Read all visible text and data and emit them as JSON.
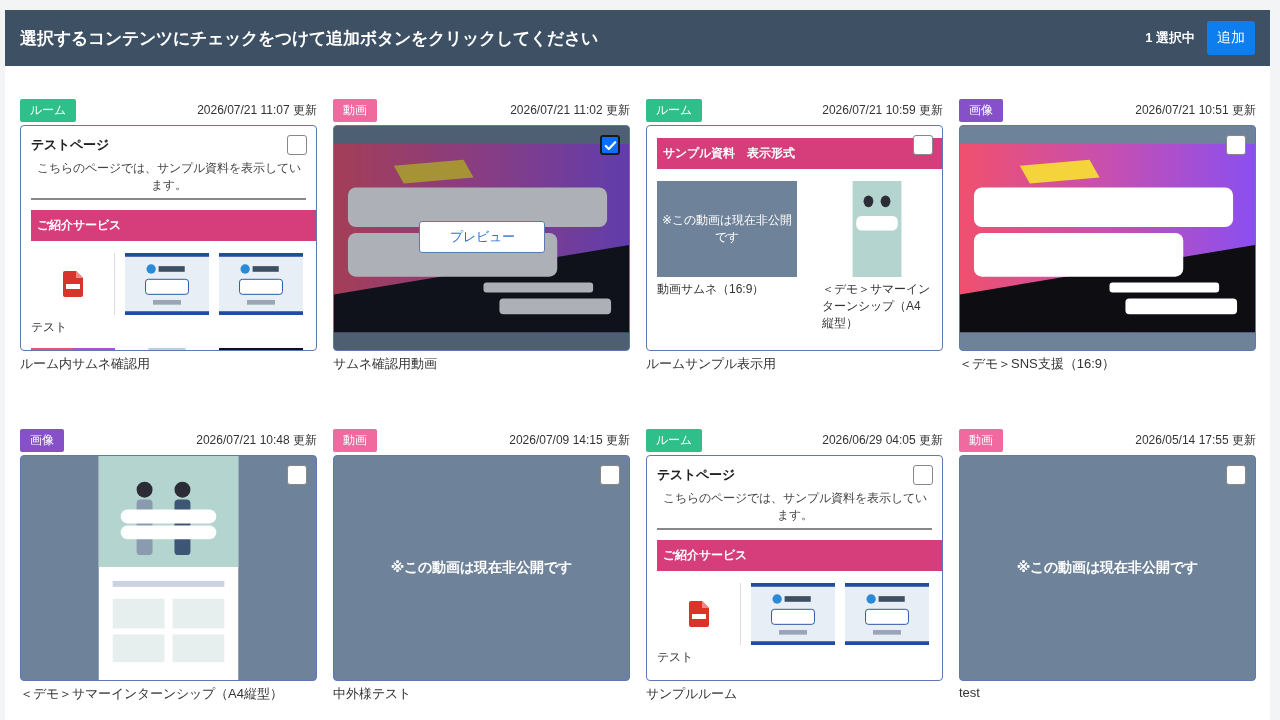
{
  "header": {
    "title": "選択するコンテンツにチェックをつけて追加ボタンをクリックしてください",
    "selection_count": "1 選択中",
    "add_button": "追加"
  },
  "cards": [
    {
      "tag": {
        "label": "ルーム",
        "color": "#2fbf8a"
      },
      "updated": "2026/07/21 11:07 更新",
      "title": "ルーム内サムネ確認用",
      "selected": false,
      "thumbnail": {
        "kind": "room",
        "heading": "テストページ",
        "intro": "こちらのページでは、サンプル資料を表示しています。",
        "section": "ご紹介サービス",
        "items": [
          {
            "kind": "pdf",
            "caption": "テスト"
          },
          {
            "kind": "tile"
          },
          {
            "kind": "tile"
          },
          {
            "kind": "banner"
          },
          {
            "kind": "poster"
          },
          {
            "kind": "dark"
          }
        ]
      }
    },
    {
      "tag": {
        "label": "動画",
        "color": "#f06aa0"
      },
      "updated": "2026/07/21 11:02 更新",
      "title": "サムネ確認用動画",
      "selected": true,
      "preview": {
        "label": "プレビュー"
      },
      "thumbnail": {
        "kind": "banner"
      }
    },
    {
      "tag": {
        "label": "ルーム",
        "color": "#2fbf8a"
      },
      "updated": "2026/07/21 10:59 更新",
      "title": "ルームサンプル表示用",
      "selected": false,
      "thumbnail": {
        "kind": "room",
        "section": "サンプル資料　表示形式",
        "items": [
          {
            "kind": "private",
            "text": "※この動画は現在非公開です",
            "caption": "動画サムネ（16:9）"
          },
          {
            "kind": "poster",
            "caption": "＜デモ＞サマーインターンシップ（A4縦型）"
          }
        ]
      }
    },
    {
      "tag": {
        "label": "画像",
        "color": "#8550c8"
      },
      "updated": "2026/07/21 10:51 更新",
      "title": "＜デモ＞SNS支援（16:9）",
      "selected": false,
      "thumbnail": {
        "kind": "banner"
      }
    },
    {
      "tag": {
        "label": "画像",
        "color": "#8550c8"
      },
      "updated": "2026/07/21 10:48 更新",
      "title": "＜デモ＞サマーインターンシップ（A4縦型）",
      "selected": false,
      "thumbnail": {
        "kind": "poster"
      }
    },
    {
      "tag": {
        "label": "動画",
        "color": "#f06aa0"
      },
      "updated": "2026/07/09 14:15 更新",
      "title": "中外様テスト",
      "selected": false,
      "thumbnail": {
        "kind": "private",
        "text": "※この動画は現在非公開です"
      }
    },
    {
      "tag": {
        "label": "ルーム",
        "color": "#2fbf8a"
      },
      "updated": "2026/06/29 04:05 更新",
      "title": "サンプルルーム",
      "selected": false,
      "thumbnail": {
        "kind": "room",
        "heading": "テストページ",
        "intro": "こちらのページでは、サンプル資料を表示しています。",
        "section": "ご紹介サービス",
        "items": [
          {
            "kind": "pdf",
            "caption": "テスト"
          },
          {
            "kind": "tile"
          },
          {
            "kind": "tile"
          }
        ]
      }
    },
    {
      "tag": {
        "label": "動画",
        "color": "#f06aa0"
      },
      "updated": "2026/05/14 17:55 更新",
      "title": "test",
      "selected": false,
      "thumbnail": {
        "kind": "private",
        "text": "※この動画は現在非公開です"
      }
    }
  ]
}
